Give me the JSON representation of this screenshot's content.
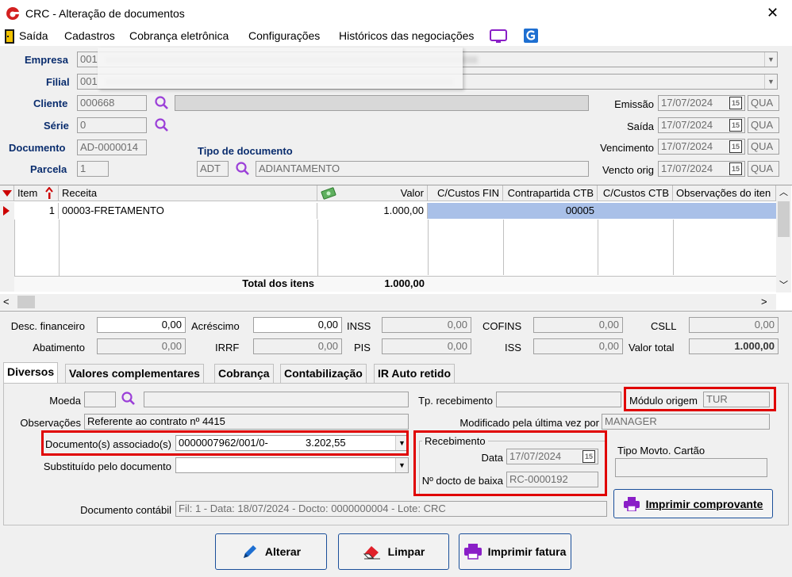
{
  "window": {
    "title": "CRC - Alteração de documentos",
    "close": "✕"
  },
  "menu": [
    "Saída",
    "Cadastros",
    "Cobrança eletrônica",
    "Configurações",
    "Históricos das negociações"
  ],
  "header": {
    "empresa_label": "Empresa",
    "empresa_value": "001",
    "filial_label": "Filial",
    "filial_value": "001",
    "cliente_label": "Cliente",
    "cliente_value": "000668",
    "serie_label": "Série",
    "serie_value": "0",
    "documento_label": "Documento",
    "documento_value": "AD-0000014",
    "parcela_label": "Parcela",
    "parcela_value": "1",
    "tipo_doc_label": "Tipo de documento",
    "tipo_doc_code": "ADT",
    "tipo_doc_desc": "ADIANTAMENTO"
  },
  "dates": [
    {
      "label": "Emissão",
      "value": "17/07/2024",
      "day": "QUA"
    },
    {
      "label": "Saída",
      "value": "17/07/2024",
      "day": "QUA"
    },
    {
      "label": "Vencimento",
      "value": "17/07/2024",
      "day": "QUA"
    },
    {
      "label": "Vencto orig",
      "value": "17/07/2024",
      "day": "QUA"
    }
  ],
  "calendar_icon": "15",
  "grid": {
    "headers": [
      "Item",
      "Receita",
      "Valor",
      "C/Custos FIN",
      "Contrapartida CTB",
      "C/Custos CTB",
      "Observações do iten"
    ],
    "rows": [
      {
        "item": "1",
        "receita": "00003-FRETAMENTO",
        "valor": "1.000,00",
        "ccfin": "",
        "contrapartida": "00005",
        "ccctb": "",
        "obs": ""
      }
    ],
    "total_label": "Total dos itens",
    "total_value": "1.000,00"
  },
  "totals": {
    "desc_fin_label": "Desc. financeiro",
    "desc_fin": "0,00",
    "acrescimo_label": "Acréscimo",
    "acrescimo": "0,00",
    "inss_label": "INSS",
    "inss": "0,00",
    "cofins_label": "COFINS",
    "cofins": "0,00",
    "csll_label": "CSLL",
    "csll": "0,00",
    "abatimento_label": "Abatimento",
    "abatimento": "0,00",
    "irrf_label": "IRRF",
    "irrf": "0,00",
    "pis_label": "PIS",
    "pis": "0,00",
    "iss_label": "ISS",
    "iss": "0,00",
    "valor_total_label": "Valor total",
    "valor_total": "1.000,00"
  },
  "tabs": [
    "Diversos",
    "Valores complementares",
    "Cobrança",
    "Contabilização",
    "IR Auto retido"
  ],
  "diversos": {
    "moeda_label": "Moeda",
    "obs_label": "Observações",
    "obs_value": "Referente ao contrato nº 4415",
    "doc_assoc_label": "Documento(s) associado(s)",
    "doc_assoc_value": "0000007962/001/0-",
    "doc_assoc_amount": "3.202,55",
    "substituido_label": "Substituído pelo documento",
    "doc_contabil_label": "Documento contábil",
    "doc_contabil_value": "Fil: 1 - Data: 18/07/2024 - Docto: 0000000004 - Lote: CRC",
    "tp_recebimento_label": "Tp. recebimento",
    "modulo_origem_label": "Módulo origem",
    "modulo_origem_value": "TUR",
    "modificado_label": "Modificado pela última vez por",
    "modificado_value": "MANAGER",
    "recebimento_group": "Recebimento",
    "data_label": "Data",
    "data_value": "17/07/2024",
    "nro_baixa_label": "Nº docto de baixa",
    "nro_baixa_value": "RC-0000192",
    "tipo_movto_label": "Tipo Movto. Cartão",
    "imprimir_comprovante": "Imprimir comprovante"
  },
  "buttons": {
    "alterar": "Alterar",
    "limpar": "Limpar",
    "imprimir_fatura": "Imprimir fatura"
  }
}
